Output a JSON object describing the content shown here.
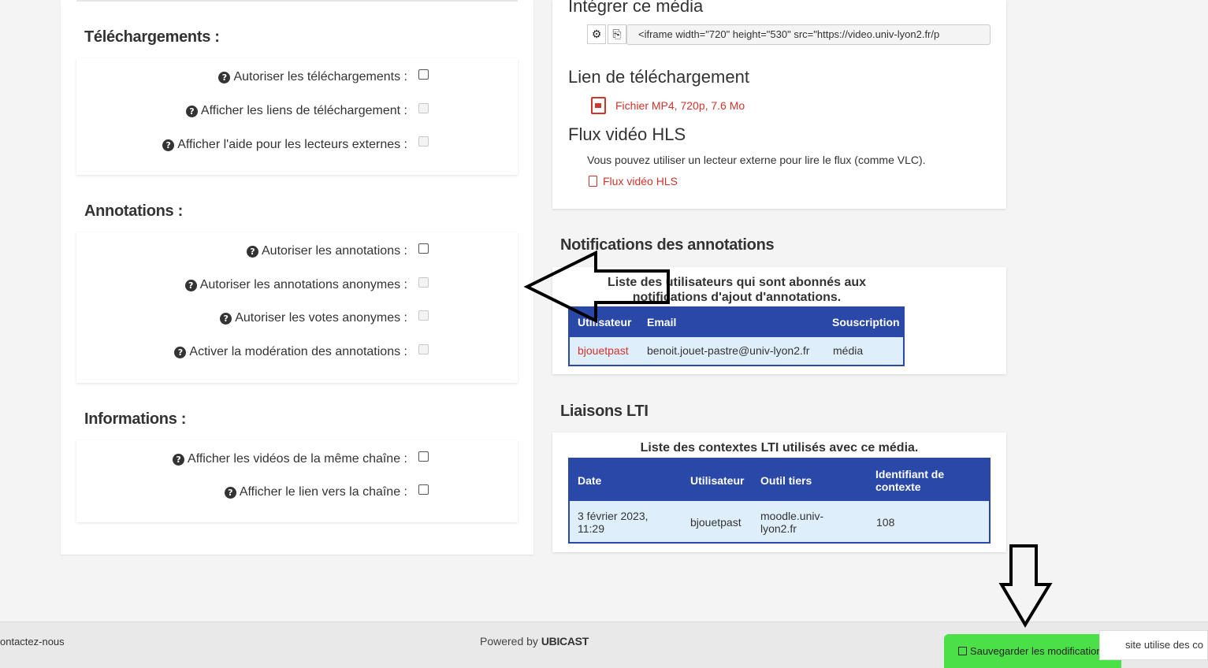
{
  "left": {
    "telechargements": {
      "title": "Téléchargements :",
      "rows": [
        {
          "label": "Autoriser les téléchargements :",
          "checked": false,
          "disabled": false
        },
        {
          "label": "Afficher les liens de téléchargement :",
          "checked": false,
          "disabled": true
        },
        {
          "label": "Afficher l'aide pour les lecteurs externes :",
          "checked": false,
          "disabled": true
        }
      ]
    },
    "annotations": {
      "title": "Annotations :",
      "rows": [
        {
          "label": "Autoriser les annotations :",
          "checked": false,
          "disabled": false
        },
        {
          "label": "Autoriser les annotations anonymes :",
          "checked": false,
          "disabled": true
        },
        {
          "label": "Autoriser les votes anonymes :",
          "checked": false,
          "disabled": true
        },
        {
          "label": "Activer la modération des annotations :",
          "checked": false,
          "disabled": true
        }
      ]
    },
    "informations": {
      "title": "Informations :",
      "rows": [
        {
          "label": "Afficher les vidéos de la même chaîne :",
          "checked": false,
          "disabled": false
        },
        {
          "label": "Afficher le lien vers la chaîne :",
          "checked": false,
          "disabled": false
        }
      ]
    },
    "help_icon": "question-circle-icon"
  },
  "right": {
    "embed": {
      "title": "Intégrer ce média",
      "code": "<iframe width=\"720\" height=\"530\" src=\"https://video.univ-lyon2.fr/p",
      "settings_icon": "gear-icon",
      "copy_icon": "copy-icon"
    },
    "download": {
      "title": "Lien de téléchargement",
      "link": "Fichier MP4, 720p, 7.6 Mo"
    },
    "hls": {
      "title": "Flux vidéo HLS",
      "text": "Vous pouvez utiliser un lecteur externe pour lire le flux (comme VLC).",
      "link": "Flux vidéo HLS"
    },
    "notifications": {
      "title": "Notifications des annotations",
      "caption": "Liste des utilisateurs qui sont abonnés aux notifications d'ajout d'annotations.",
      "headers": [
        "Utilisateur",
        "Email",
        "Souscription"
      ],
      "rows": [
        {
          "user": "bjouetpast",
          "email": "benoit.jouet-pastre@univ-lyon2.fr",
          "subscription": "média"
        }
      ]
    },
    "lti": {
      "title": "Liaisons LTI",
      "caption": "Liste des contextes LTI utilisés avec ce média.",
      "headers": [
        "Date",
        "Utilisateur",
        "Outil tiers",
        "Identifiant de contexte"
      ],
      "rows": [
        {
          "date": "3 février 2023, 11:29",
          "user": "bjouetpast",
          "tool": "moodle.univ-lyon2.fr",
          "context": "108"
        }
      ]
    }
  },
  "footer": {
    "contact": "ontactez-nous",
    "powered_prefix": "Powered by",
    "powered_brand": "UBICAST",
    "save_label": "Sauvegarder les modifications",
    "cookie_text": "site utilise des co"
  },
  "colors": {
    "link": "#d0342c",
    "table_header": "#2a48a8",
    "table_row": "#dfeefb",
    "save_button": "#4ce048"
  }
}
